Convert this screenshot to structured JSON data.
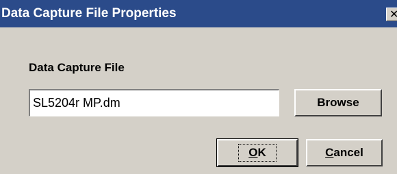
{
  "window": {
    "title": "Data Capture File Properties",
    "close_glyph": "✕",
    "close_icon": "close-icon"
  },
  "form": {
    "file_label": "Data Capture File",
    "file_value": "SL5204r MP.dm",
    "browse_label": "Browse"
  },
  "buttons": {
    "ok_mnemonic": "O",
    "ok_rest": "K",
    "cancel_mnemonic": "C",
    "cancel_rest": "ancel"
  },
  "colors": {
    "titlebar": "#2b4b8a",
    "dialog_bg": "#d4d0c8"
  }
}
